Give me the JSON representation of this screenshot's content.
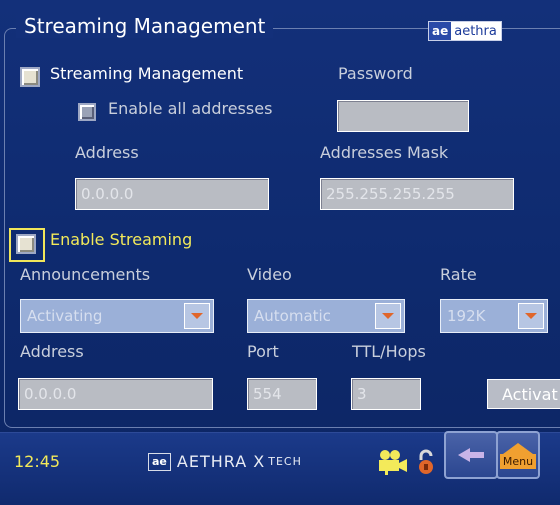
{
  "window": {
    "title": "Streaming Management",
    "logo_mark": "ae",
    "logo_text": "aethra"
  },
  "management": {
    "checkbox_label": "Streaming Management",
    "enable_all_label": "Enable all addresses",
    "password_label": "Password",
    "password_value": "",
    "address_label": "Address",
    "address_value": "0.0.0.0",
    "mask_label": "Addresses Mask",
    "mask_value": "255.255.255.255"
  },
  "streaming": {
    "checkbox_label": "Enable Streaming",
    "announcements_label": "Announcements",
    "announcements_value": "Activating",
    "video_label": "Video",
    "video_value": "Automatic",
    "rate_label": "Rate",
    "rate_value": "192K",
    "address_label": "Address",
    "address_value": "0.0.0.0",
    "port_label": "Port",
    "port_value": "554",
    "ttl_label": "TTL/Hops",
    "ttl_value": "3",
    "activate_label": "Activat"
  },
  "statusbar": {
    "time": "12:45",
    "brand_mark": "ae",
    "brand_name": "AETHRA X",
    "brand_sub": "TECH",
    "menu_label": "Menu"
  },
  "colors": {
    "background": "#13307a",
    "focus": "#f1e65a",
    "label": "#c9cfdc"
  }
}
